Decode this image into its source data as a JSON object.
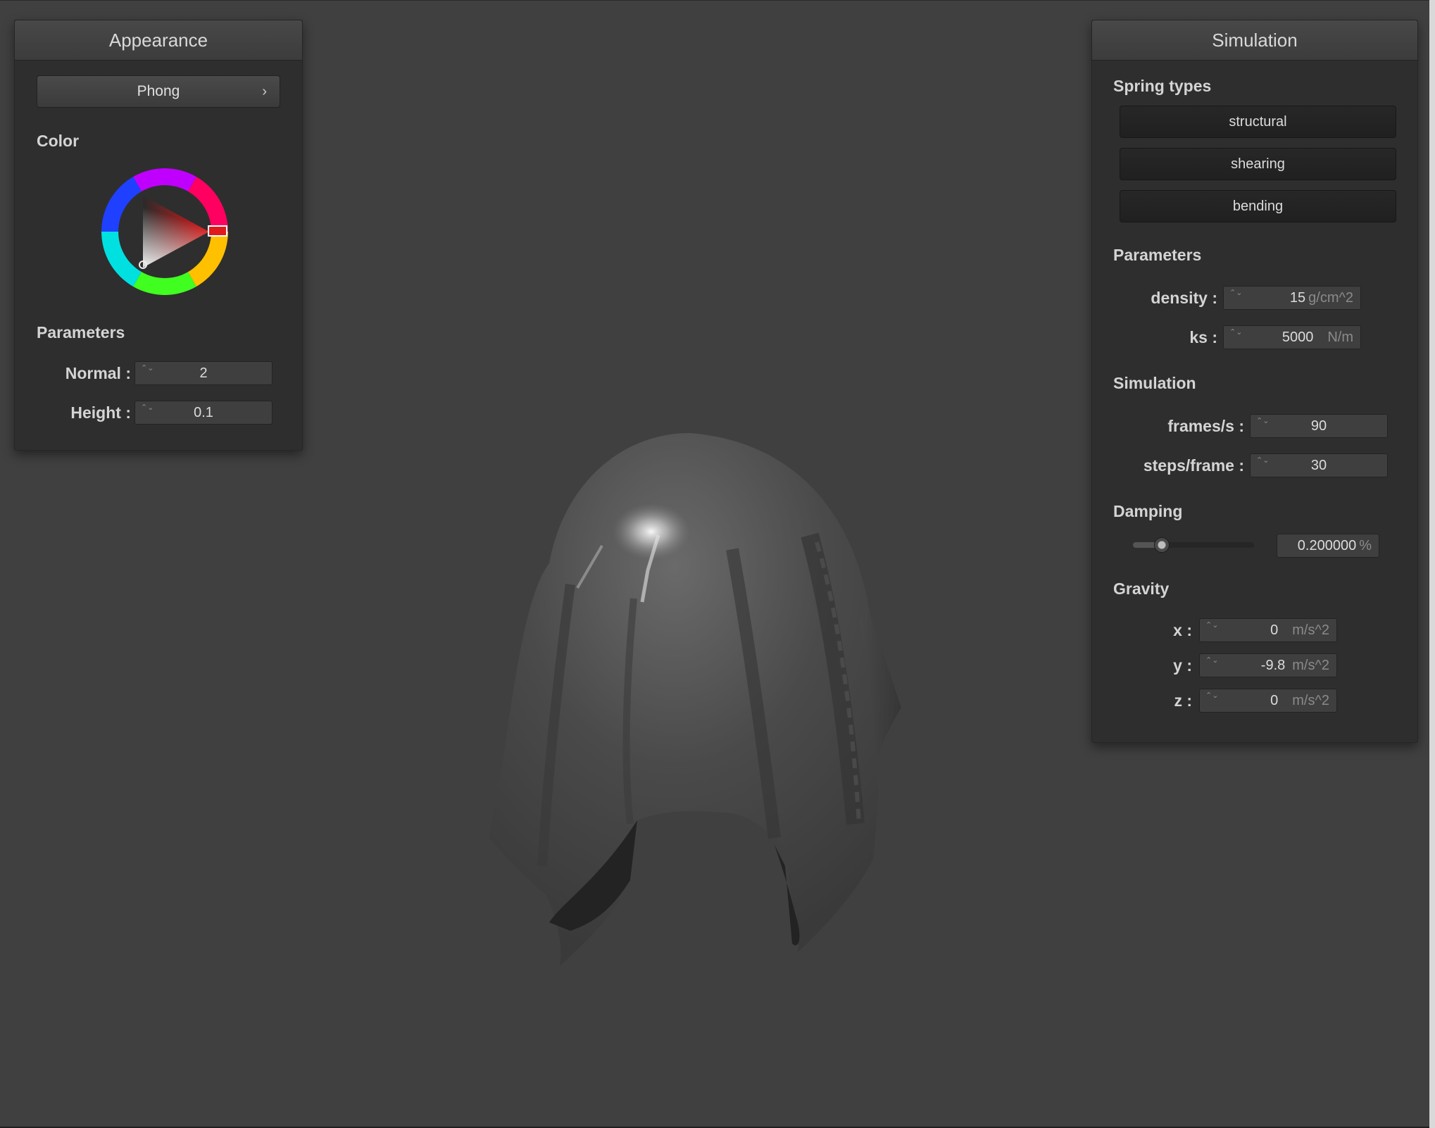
{
  "appearance": {
    "title": "Appearance",
    "shader": "Phong",
    "shader_chevron": "›",
    "color_title": "Color",
    "color_hex": "#e01a1a",
    "params_title": "Parameters",
    "normal_label": "Normal :",
    "normal_value": "2",
    "height_label": "Height :",
    "height_value": "0.1"
  },
  "simulation": {
    "title": "Simulation",
    "spring_title": "Spring types",
    "spring_types": [
      "structural",
      "shearing",
      "bending"
    ],
    "params_title": "Parameters",
    "density_label": "density :",
    "density_value": "15",
    "density_unit": "g/cm^2",
    "ks_label": "ks :",
    "ks_value": "5000",
    "ks_unit": "N/m",
    "sim_title": "Simulation",
    "fps_label": "frames/s :",
    "fps_value": "90",
    "steps_label": "steps/frame :",
    "steps_value": "30",
    "damping_title": "Damping",
    "damping_value": "0.200000",
    "damping_unit": "%",
    "damping_level": 0.2,
    "gravity_title": "Gravity",
    "gx_label": "x :",
    "gx_value": "0",
    "gy_label": "y :",
    "gy_value": "-9.8",
    "gz_label": "z :",
    "gz_value": "0",
    "gravity_unit": "m/s^2"
  },
  "spinner_arrows": "⌃⌄",
  "colors": {
    "background": "#404040",
    "panel": "#2e2e2e",
    "cloth": "#4a4a4a"
  }
}
